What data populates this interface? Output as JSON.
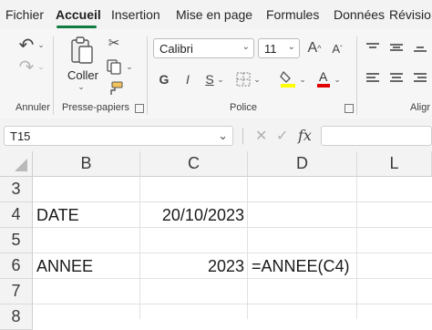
{
  "tabs": [
    "Fichier",
    "Accueil",
    "Insertion",
    "Mise en page",
    "Formules",
    "Données",
    "Révisio"
  ],
  "ribbon": {
    "undo_group_label": "Annuler",
    "clipboard": {
      "paste_label": "Coller",
      "group_label": "Presse-papiers"
    },
    "font": {
      "name": "Calibri",
      "size": "11",
      "group_label": "Police",
      "bold": "G",
      "italic": "I",
      "underline": "S"
    },
    "align_group_label": "Aligr"
  },
  "formula_bar": {
    "cell_ref": "T15",
    "fx_label": "fx",
    "content": ""
  },
  "columns": [
    "B",
    "C",
    "D",
    "L"
  ],
  "rows": [
    "3",
    "4",
    "5",
    "6",
    "7",
    "8"
  ],
  "cells": {
    "B4": "DATE",
    "C4": "20/10/2023",
    "B6": "ANNEE",
    "C6": "2023",
    "D6": "=ANNEE(C4)"
  },
  "colors": {
    "accent": "#107c41",
    "header_bg": "#f3f3f3"
  }
}
